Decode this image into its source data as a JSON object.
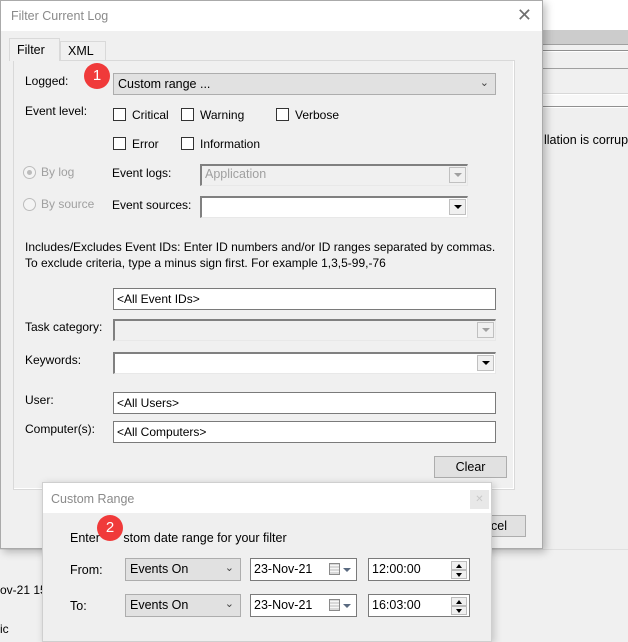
{
  "background_window": {
    "visible_text_right": "llation is corrupt",
    "visible_text_bottom_1": "ov-21 15",
    "visible_text_bottom_2": "ic"
  },
  "filter_dialog": {
    "title": "Filter Current Log",
    "close_icon": "close-icon",
    "tabs": [
      {
        "label": "Filter",
        "active": true
      },
      {
        "label": "XML",
        "active": false
      }
    ],
    "logged": {
      "label": "Logged:",
      "value": "Custom range ..."
    },
    "event_level": {
      "label": "Event level:",
      "options": [
        {
          "label": "Critical",
          "checked": false
        },
        {
          "label": "Warning",
          "checked": false
        },
        {
          "label": "Verbose",
          "checked": false
        },
        {
          "label": "Error",
          "checked": false
        },
        {
          "label": "Information",
          "checked": false
        }
      ]
    },
    "by_log": {
      "label": "By log",
      "checked": true,
      "enabled": false
    },
    "by_source": {
      "label": "By source",
      "checked": false,
      "enabled": false
    },
    "event_logs": {
      "label": "Event logs:",
      "value": "Application",
      "enabled": false
    },
    "event_sources": {
      "label": "Event sources:",
      "value": ""
    },
    "description": "Includes/Excludes Event IDs: Enter ID numbers and/or ID ranges separated by commas. To exclude criteria, type a minus sign first. For example 1,3,5-99,-76",
    "event_ids": {
      "value": "<All Event IDs>"
    },
    "task_category": {
      "label": "Task category:",
      "value": "",
      "enabled": false
    },
    "keywords": {
      "label": "Keywords:",
      "value": ""
    },
    "user": {
      "label": "User:",
      "value": "<All Users>"
    },
    "computers": {
      "label": "Computer(s):",
      "value": "<All Computers>"
    },
    "clear_button": "Clear",
    "cancel_button_partial": "cel"
  },
  "custom_range_dialog": {
    "title": "Custom Range",
    "close_icon": "close-icon",
    "instruction": "Enter a custom date range for your filter",
    "instruction_visible_left": "Enter ",
    "instruction_visible_right": "stom date range for your filter",
    "from": {
      "label": "From:",
      "mode": "Events On",
      "date": "23-Nov-21",
      "time": "12:00:00"
    },
    "to": {
      "label": "To:",
      "mode": "Events On",
      "date": "23-Nov-21",
      "time": "16:03:00"
    }
  },
  "annotations": [
    {
      "number": "1",
      "color": "#f03a3a"
    },
    {
      "number": "2",
      "color": "#f03a3a"
    }
  ]
}
